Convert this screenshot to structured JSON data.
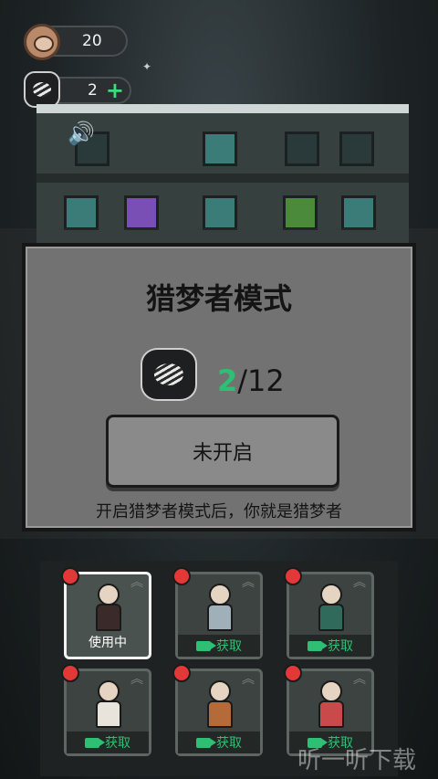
{
  "hud": {
    "coins": "20",
    "puzzles": "2",
    "plus_symbol": "+",
    "coin_icon": "bear-coin-icon",
    "puzzle_icon": "puzzle-piece-icon"
  },
  "modal": {
    "title": "猎梦者模式",
    "progress_current": "2",
    "progress_total": "/12",
    "button_label": "未开启",
    "description": "开启猎梦者模式后，你就是猎梦者"
  },
  "characters": [
    {
      "status": "使用中",
      "active": true,
      "body_color": "#3a2a2a"
    },
    {
      "status": "获取",
      "active": false,
      "body_color": "#9fb0b8"
    },
    {
      "status": "获取",
      "active": false,
      "body_color": "#2f6a5a"
    },
    {
      "status": "获取",
      "active": false,
      "body_color": "#e8e4dc"
    },
    {
      "status": "获取",
      "active": false,
      "body_color": "#b56a3a"
    },
    {
      "status": "获取",
      "active": false,
      "body_color": "#c84a4a"
    }
  ],
  "watermark": "听一听下载",
  "colors": {
    "accent_green": "#2fbf74",
    "badge_red": "#e23838"
  }
}
